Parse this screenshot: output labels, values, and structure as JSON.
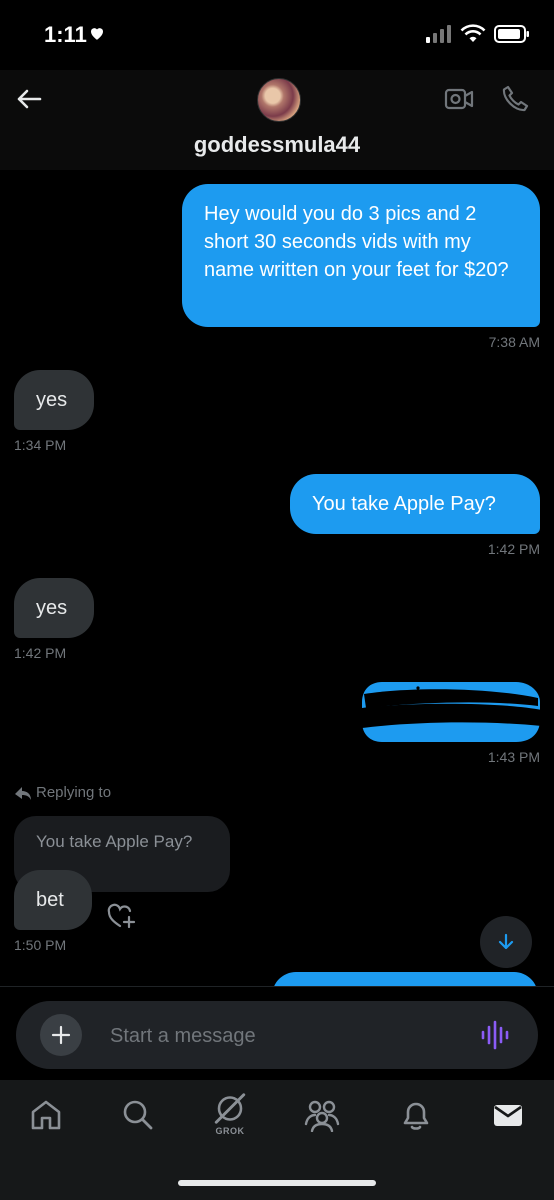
{
  "status": {
    "time": "1:11"
  },
  "header": {
    "username": "goddessmula44"
  },
  "messages": {
    "m1": {
      "text": "Hey would you do 3 pics and 2 short 30 seconds vids with my name written on your feet for $20?",
      "time": "7:38 AM"
    },
    "m2": {
      "text": "yes",
      "time": "1:34 PM"
    },
    "m3": {
      "text": "You take Apple Pay?",
      "time": "1:42 PM"
    },
    "m4": {
      "text": "yes",
      "time": "1:42 PM"
    },
    "m5": {
      "time": "1:43 PM"
    },
    "m6": {
      "replying_label": "Replying to",
      "quoted_text": "You take Apple Pay?",
      "text": "bet",
      "time": "1:50 PM"
    }
  },
  "composer": {
    "placeholder": "Start a message"
  },
  "tabbar": {
    "grok_label": "GROK"
  },
  "colors": {
    "accent": "#1d9bf0",
    "incoming": "#2f3336",
    "voice": "#8b5cf6"
  }
}
